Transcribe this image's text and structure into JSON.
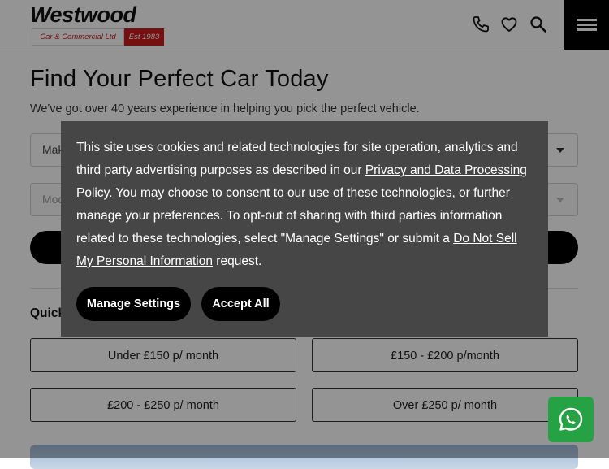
{
  "header": {
    "logo": {
      "name": "Westwood",
      "tagline": "Car & Commercial Ltd",
      "established": "Est 1983"
    },
    "icons": [
      "phone-icon",
      "heart-icon",
      "search-icon",
      "menu-icon"
    ]
  },
  "main": {
    "title": "Find Your Perfect Car Today",
    "subtitle": "We've got over 40 years experience in helping you pick the perfect vehicle.",
    "make_select": {
      "value": "Make"
    },
    "model_select": {
      "value": "Model"
    },
    "quick_search_label": "Quick",
    "quick_buttons": [
      {
        "label": "Under £150 p/ month"
      },
      {
        "label": "£150 - £200 p/month"
      },
      {
        "label": "£200 - £250 p/ month"
      },
      {
        "label": "Over £250 p/ month"
      }
    ]
  },
  "cookie_banner": {
    "text_1": "This site uses cookies and related technologies for site operation, analytics and third party advertising purposes as described in our ",
    "privacy_link": "Privacy and Data Processing Policy.",
    "text_2": " You may choose to consent to our use of these technologies, or further manage your preferences. To opt-out of sharing with third parties information related to these technologies, select \"Manage Settings\" or submit a ",
    "do_not_sell_link": "Do Not Sell My Personal Information",
    "text_3": " request.",
    "manage_settings_label": "Manage Settings",
    "accept_all_label": "Accept All"
  },
  "floating": {
    "whatsapp_icon": "whatsapp-icon"
  },
  "colors": {
    "brand_red": "#cc1a1a",
    "overlay_panel": "#464646",
    "button_black": "#000000",
    "whatsapp_green": "#25a244"
  }
}
